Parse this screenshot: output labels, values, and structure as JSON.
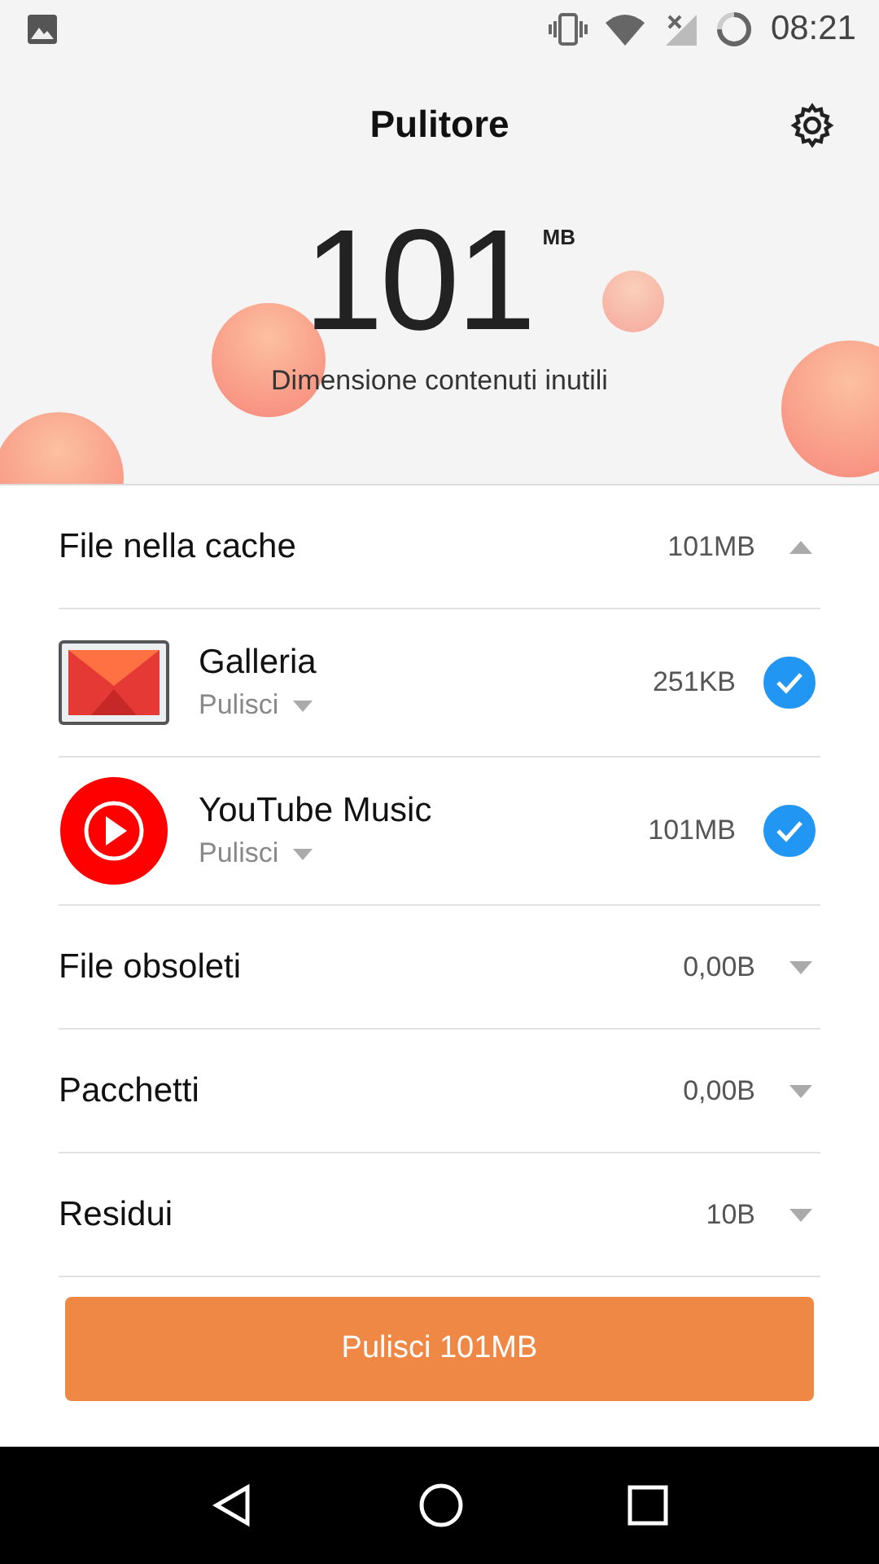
{
  "status_bar": {
    "time": "08:21"
  },
  "header": {
    "title": "Pulitore"
  },
  "summary": {
    "amount": "101",
    "unit": "MB",
    "caption": "Dimensione contenuti inutili"
  },
  "categories": [
    {
      "name": "File nella cache",
      "size": "101MB",
      "expanded": true,
      "apps": [
        {
          "kind": "gallery",
          "name": "Galleria",
          "action": "Pulisci",
          "size": "251KB",
          "checked": true
        },
        {
          "kind": "music",
          "name": "YouTube Music",
          "action": "Pulisci",
          "size": "101MB",
          "checked": true
        }
      ]
    },
    {
      "name": "File obsoleti",
      "size": "0,00B",
      "expanded": false
    },
    {
      "name": "Pacchetti",
      "size": "0,00B",
      "expanded": false
    },
    {
      "name": "Residui",
      "size": "10B",
      "expanded": false
    }
  ],
  "clean_button": {
    "label": "Pulisci 101MB"
  }
}
